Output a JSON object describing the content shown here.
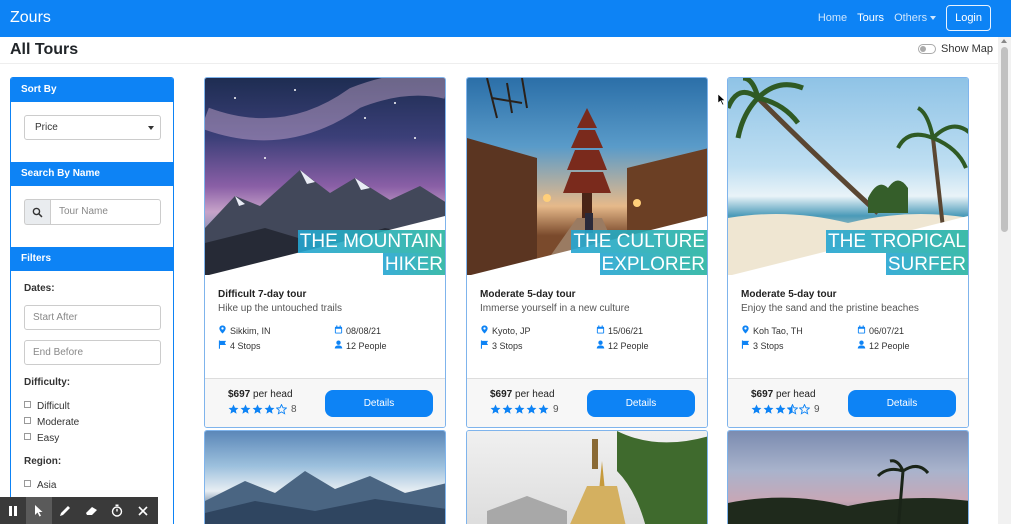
{
  "navbar": {
    "brand": "Zours",
    "links": [
      {
        "label": "Home",
        "active": false
      },
      {
        "label": "Tours",
        "active": true
      },
      {
        "label": "Others",
        "active": false
      }
    ],
    "login": "Login"
  },
  "page": {
    "title": "All Tours",
    "map_toggle": "Show Map"
  },
  "sidebar": {
    "sort_head": "Sort By",
    "sort_value": "Price",
    "search_head": "Search By Name",
    "search_placeholder": "Tour Name",
    "filters_head": "Filters",
    "dates_label": "Dates:",
    "start_placeholder": "Start After",
    "end_placeholder": "End Before",
    "difficulty_label": "Difficulty:",
    "difficulties": [
      "Difficult",
      "Moderate",
      "Easy"
    ],
    "region_label": "Region:",
    "regions": [
      "Asia"
    ]
  },
  "tours": [
    {
      "title_line1": "THE MOUNTAIN",
      "title_line2": "HIKER",
      "subtitle": "Difficult 7-day tour",
      "description": "Hike up the untouched trails",
      "location": "Sikkim, IN",
      "date": "08/08/21",
      "stops": "4 Stops",
      "people": "12 People",
      "price": "$697",
      "price_unit": "per head",
      "rating": 4,
      "rating_count": "8",
      "details": "Details"
    },
    {
      "title_line1": "THE CULTURE",
      "title_line2": "EXPLORER",
      "subtitle": "Moderate 5-day tour",
      "description": "Immerse yourself in a new culture",
      "location": "Kyoto, JP",
      "date": "15/06/21",
      "stops": "3 Stops",
      "people": "12 People",
      "price": "$697",
      "price_unit": "per head",
      "rating": 5,
      "rating_count": "9",
      "details": "Details"
    },
    {
      "title_line1": "THE TROPICAL",
      "title_line2": "SURFER",
      "subtitle": "Moderate 5-day tour",
      "description": "Enjoy the sand and the pristine beaches",
      "location": "Koh Tao, TH",
      "date": "06/07/21",
      "stops": "3 Stops",
      "people": "12 People",
      "price": "$697",
      "price_unit": "per head",
      "rating": 3.5,
      "rating_count": "9",
      "details": "Details"
    }
  ],
  "colors": {
    "primary": "#0d83f5",
    "star": "#0d83f5"
  },
  "toolbar_icons": [
    "pause-icon",
    "cursor-icon",
    "pen-icon",
    "eraser-icon",
    "timer-icon",
    "close-icon"
  ]
}
